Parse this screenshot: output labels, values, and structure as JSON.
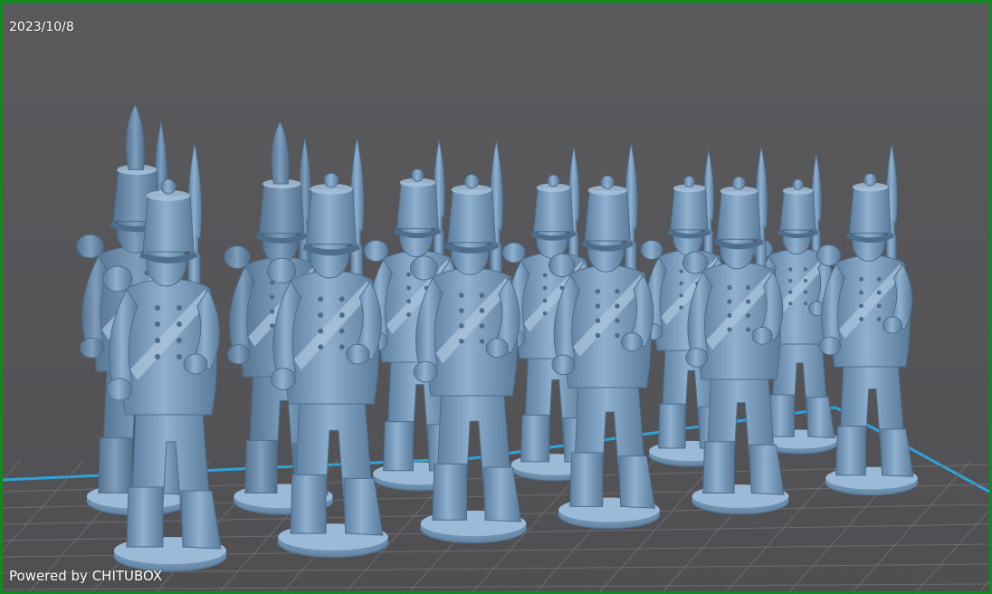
{
  "app": {
    "date": "2023/10/8",
    "brand": "Powered by CHITUBOX"
  },
  "colors": {
    "frame": "#0e8a1e",
    "background": "#58585b",
    "grid_line": "#6d6d70",
    "plate_edge": "#2ea3d8",
    "model": "#7a9cbd",
    "model_shadow": "#4d6d8c",
    "model_highlight": "#a9c4de"
  },
  "scene": {
    "object": "grenadier-miniatures",
    "model_count": 12,
    "ranks": 2
  }
}
